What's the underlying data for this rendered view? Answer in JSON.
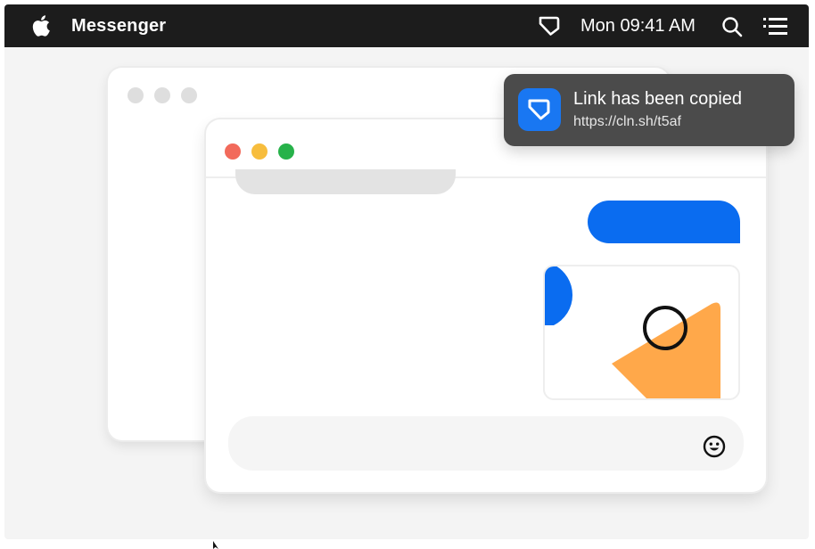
{
  "menubar": {
    "app_name": "Messenger",
    "clock": "Mon 09:41 AM",
    "icons": [
      "apple-logo-icon",
      "cleanshot-icon",
      "search-icon",
      "list-menu-icon"
    ]
  },
  "notification": {
    "title": "Link has been copied",
    "url": "https://cln.sh/t5af",
    "icon": "cleanshot-icon"
  },
  "chat": {
    "composer_icon": "emoji-icon"
  },
  "colors": {
    "menubar": "#1c1c1c",
    "accent_blue": "#0a6cf0",
    "close": "#f26a5b",
    "minimize": "#f7bd3d",
    "maximize": "#27b24a",
    "orange_shape": "#ffa84a",
    "toast_bg": "#4b4b4b"
  }
}
